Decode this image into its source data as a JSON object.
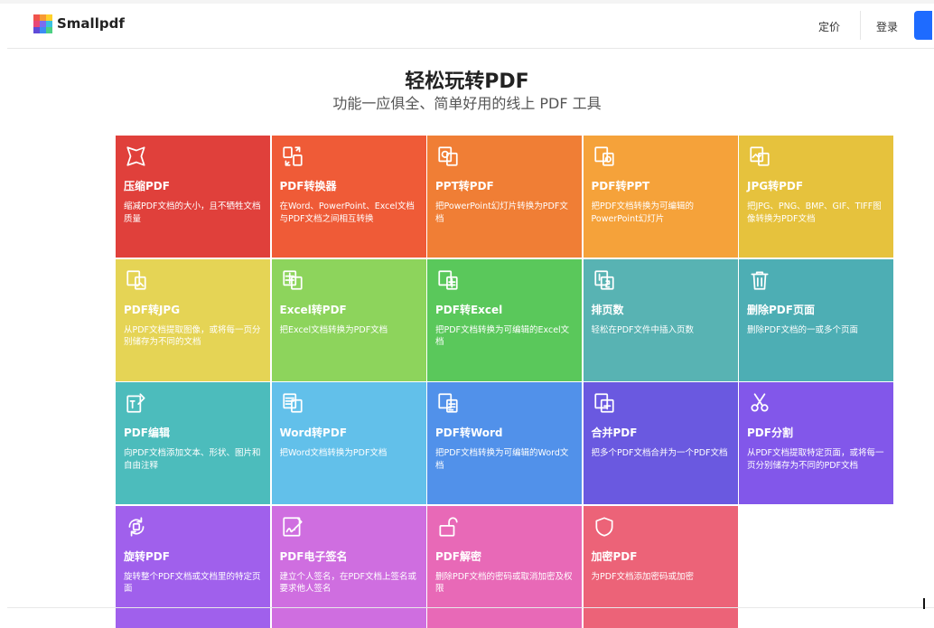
{
  "header": {
    "brand": "Smallpdf",
    "nav_pricing": "定价",
    "nav_login": "登录"
  },
  "hero": {
    "title": "轻松玩转PDF",
    "subtitle": "功能一应俱全、简单好用的线上 PDF 工具"
  },
  "colors": {
    "logo": [
      "#f0534c",
      "#f89a33",
      "#ffd12b",
      "#e94877",
      "#7b6cf0",
      "#39c1e0",
      "#5f4bd8",
      "#3c8cf5",
      "#4dd083"
    ]
  },
  "tools": [
    {
      "icon": "compress-icon",
      "title": "压缩PDF",
      "desc": "缩减PDF文档的大小，且不牺牲文档质量",
      "color": "#e0403b"
    },
    {
      "icon": "convert-arrows-icon",
      "title": "PDF转换器",
      "desc": "在Word、PowerPoint、Excel文档与PDF文档之间相互转换",
      "color": "#ef5b37"
    },
    {
      "icon": "ppt-to-pdf-icon",
      "title": "PPT转PDF",
      "desc": "把PowerPoint幻灯片转换为PDF文档",
      "color": "#f07e35"
    },
    {
      "icon": "pdf-to-ppt-icon",
      "title": "PDF转PPT",
      "desc": "把PDF文档转换为可编辑的PowerPoint幻灯片",
      "color": "#f5a23a"
    },
    {
      "icon": "jpg-to-pdf-icon",
      "title": "JPG转PDF",
      "desc": "把JPG、PNG、BMP、GIF、TIFF图像转换为PDF文档",
      "color": "#e6c23d"
    },
    {
      "icon": "pdf-to-jpg-icon",
      "title": "PDF转JPG",
      "desc": "从PDF文档提取图像，或将每一页分别储存为不同的文档",
      "color": "#e5d455"
    },
    {
      "icon": "excel-to-pdf-icon",
      "title": "Excel转PDF",
      "desc": "把Excel文档转换为PDF文档",
      "color": "#8dd45c"
    },
    {
      "icon": "pdf-to-excel-icon",
      "title": "PDF转Excel",
      "desc": "把PDF文档转换为可编辑的Excel文档",
      "color": "#5ac85b"
    },
    {
      "icon": "page-number-icon",
      "title": "排页数",
      "desc": "轻松在PDF文件中插入页数",
      "color": "#58b3b3"
    },
    {
      "icon": "trash-icon",
      "title": "删除PDF页面",
      "desc": "删除PDF文档的一或多个页面",
      "color": "#4daeb4"
    },
    {
      "icon": "edit-text-icon",
      "title": "PDF编辑",
      "desc": "向PDF文档添加文本、形状、图片和自由注释",
      "color": "#4cbcbc"
    },
    {
      "icon": "word-to-pdf-icon",
      "title": "Word转PDF",
      "desc": "把Word文档转换为PDF文档",
      "color": "#62c0ea"
    },
    {
      "icon": "pdf-to-word-icon",
      "title": "PDF转Word",
      "desc": "把PDF文档转换为可编辑的Word文档",
      "color": "#5191ea"
    },
    {
      "icon": "merge-icon",
      "title": "合并PDF",
      "desc": "把多个PDF文档合并为一个PDF文档",
      "color": "#6a59e0"
    },
    {
      "icon": "scissors-icon",
      "title": "PDF分割",
      "desc": "从PDF文档提取特定页面，或将每一页分别储存为不同的PDF文档",
      "color": "#8257ea"
    },
    {
      "icon": "rotate-icon",
      "title": "旋转PDF",
      "desc": "旋转整个PDF文档或文档里的特定页面",
      "color": "#a060ec"
    },
    {
      "icon": "signature-icon",
      "title": "PDF电子签名",
      "desc": "建立个人签名，在PDF文档上签名或要求他人签名",
      "color": "#cf6ee0"
    },
    {
      "icon": "unlock-icon",
      "title": "PDF解密",
      "desc": "删除PDF文档的密码或取消加密及权限",
      "color": "#e869b7"
    },
    {
      "icon": "shield-icon",
      "title": "加密PDF",
      "desc": "为PDF文档添加密码或加密",
      "color": "#ec6378"
    }
  ]
}
